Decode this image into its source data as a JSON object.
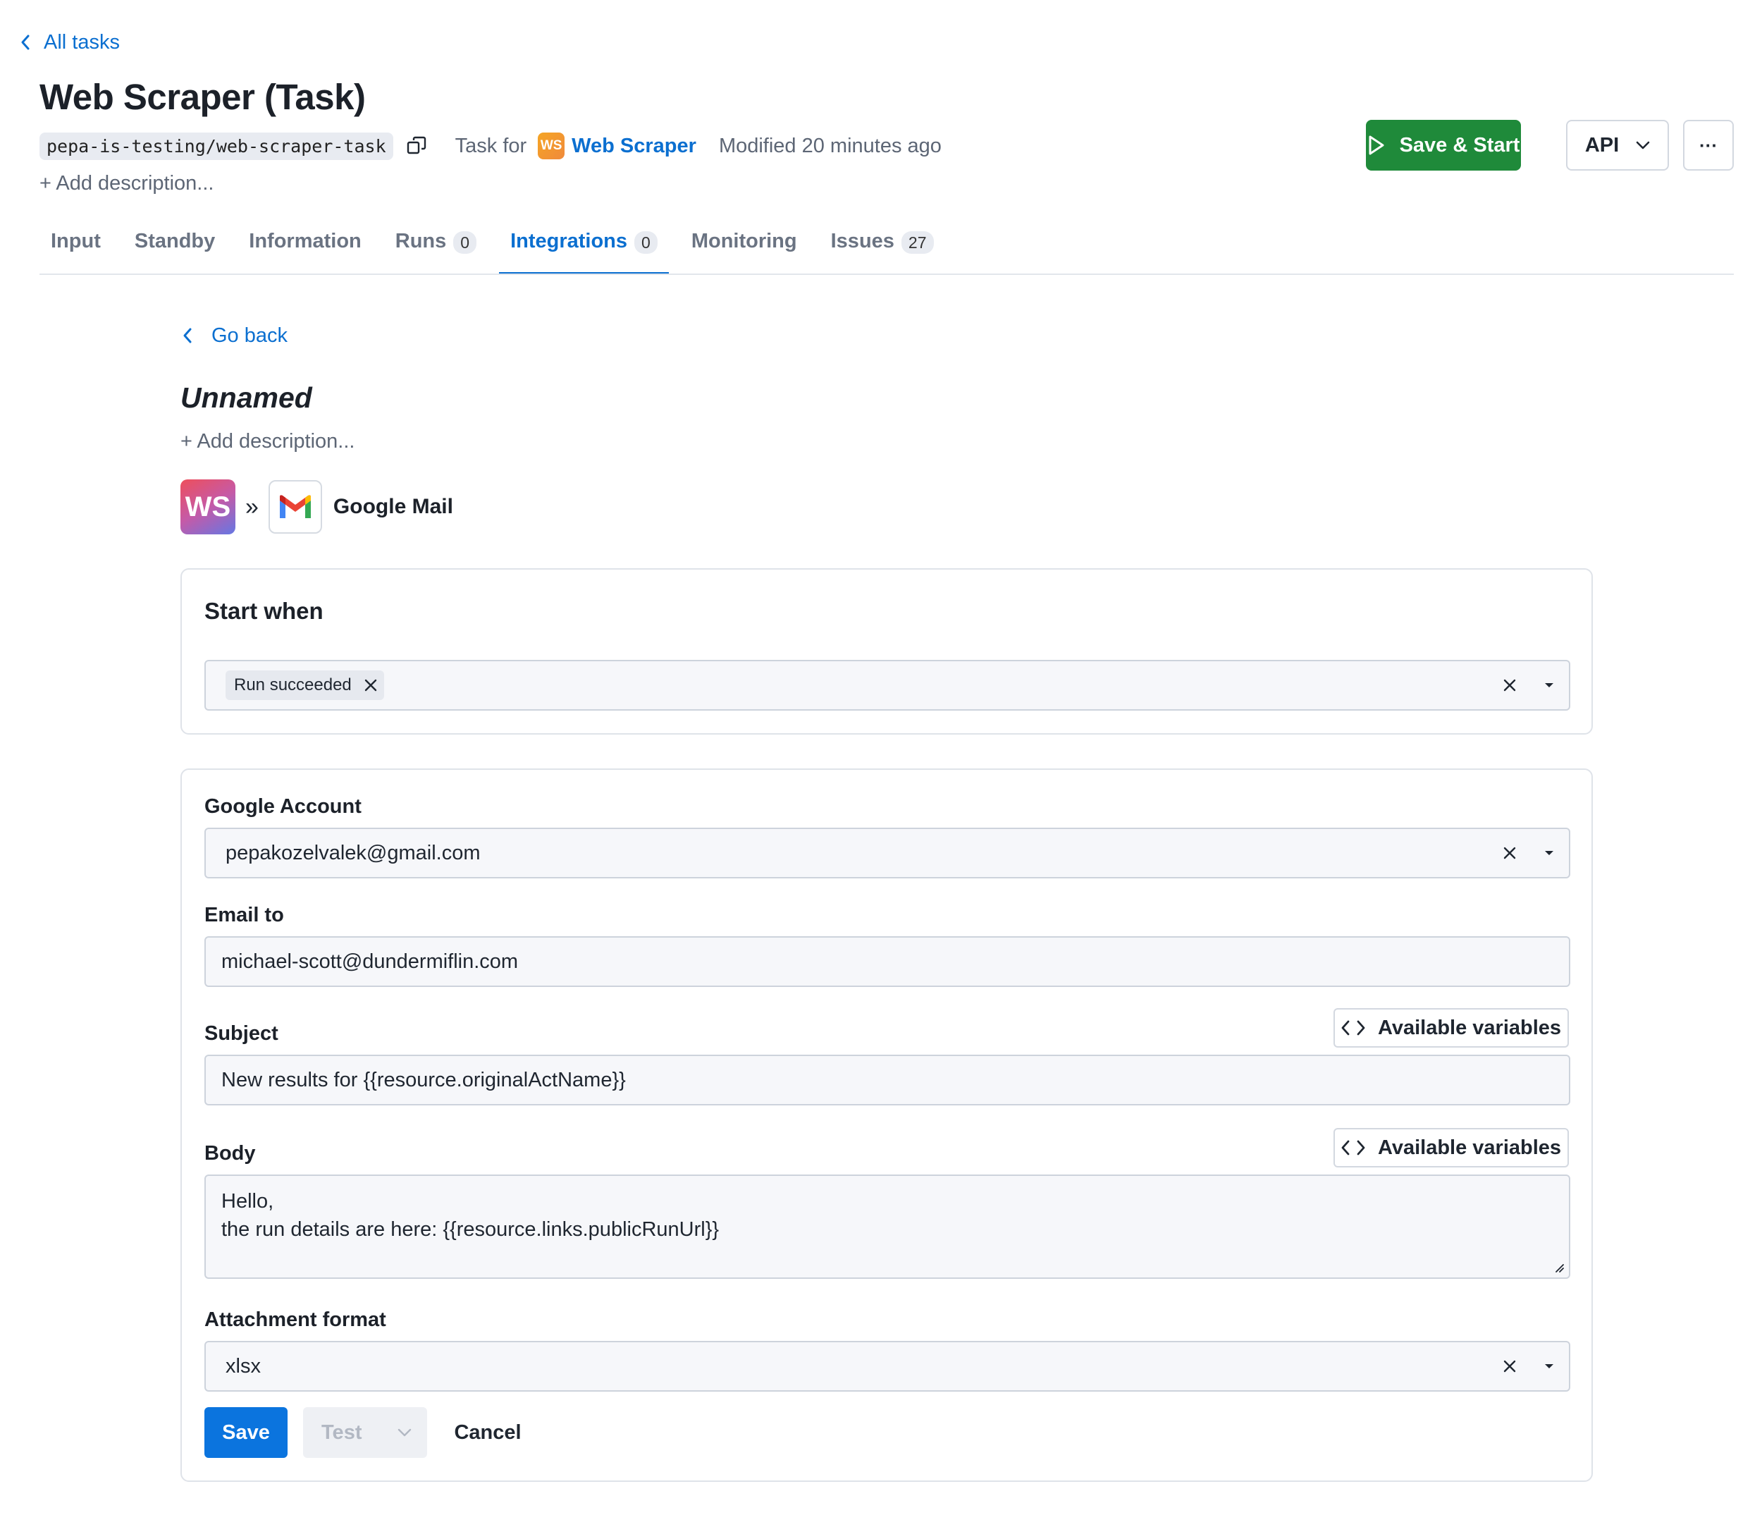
{
  "nav": {
    "back_label": "All tasks"
  },
  "header": {
    "title": "Web Scraper (Task)",
    "slug": "pepa-is-testing/web-scraper-task",
    "task_for_label": "Task for",
    "actor_badge": "WS",
    "actor_name": "Web Scraper",
    "modified": "Modified 20 minutes ago",
    "add_description": "+ Add description...",
    "save_start_label": "Save & Start",
    "api_label": "API",
    "more_label": "···"
  },
  "tabs": [
    {
      "label": "Input"
    },
    {
      "label": "Standby"
    },
    {
      "label": "Information"
    },
    {
      "label": "Runs",
      "badge": "0"
    },
    {
      "label": "Integrations",
      "badge": "0",
      "active": true
    },
    {
      "label": "Monitoring"
    },
    {
      "label": "Issues",
      "badge": "27"
    }
  ],
  "integration": {
    "go_back_label": "Go back",
    "title": "Unnamed",
    "add_description": "+ Add description...",
    "source_badge": "WS",
    "target_name": "Google Mail",
    "start_when": {
      "title": "Start when",
      "chips": [
        "Run succeeded"
      ]
    },
    "form": {
      "google_account": {
        "label": "Google Account",
        "value": "pepakozelvalek@gmail.com"
      },
      "email_to": {
        "label": "Email to",
        "value": "michael-scott@dundermiflin.com"
      },
      "subject": {
        "label": "Subject",
        "value": "New results for {{resource.originalActName}}"
      },
      "body": {
        "label": "Body",
        "line1": "Hello,",
        "line2": "the run details are here: {{resource.links.publicRunUrl}}"
      },
      "attachment_format": {
        "label": "Attachment format",
        "value": "xlsx"
      },
      "available_variables_label": "Available variables"
    },
    "actions": {
      "save_label": "Save",
      "test_label": "Test",
      "cancel_label": "Cancel"
    }
  },
  "colors": {
    "accent": "#0b6fd0",
    "primary_button": "#0b74de",
    "save_start_button": "#1f8a3a",
    "muted_text": "#5d6675"
  }
}
